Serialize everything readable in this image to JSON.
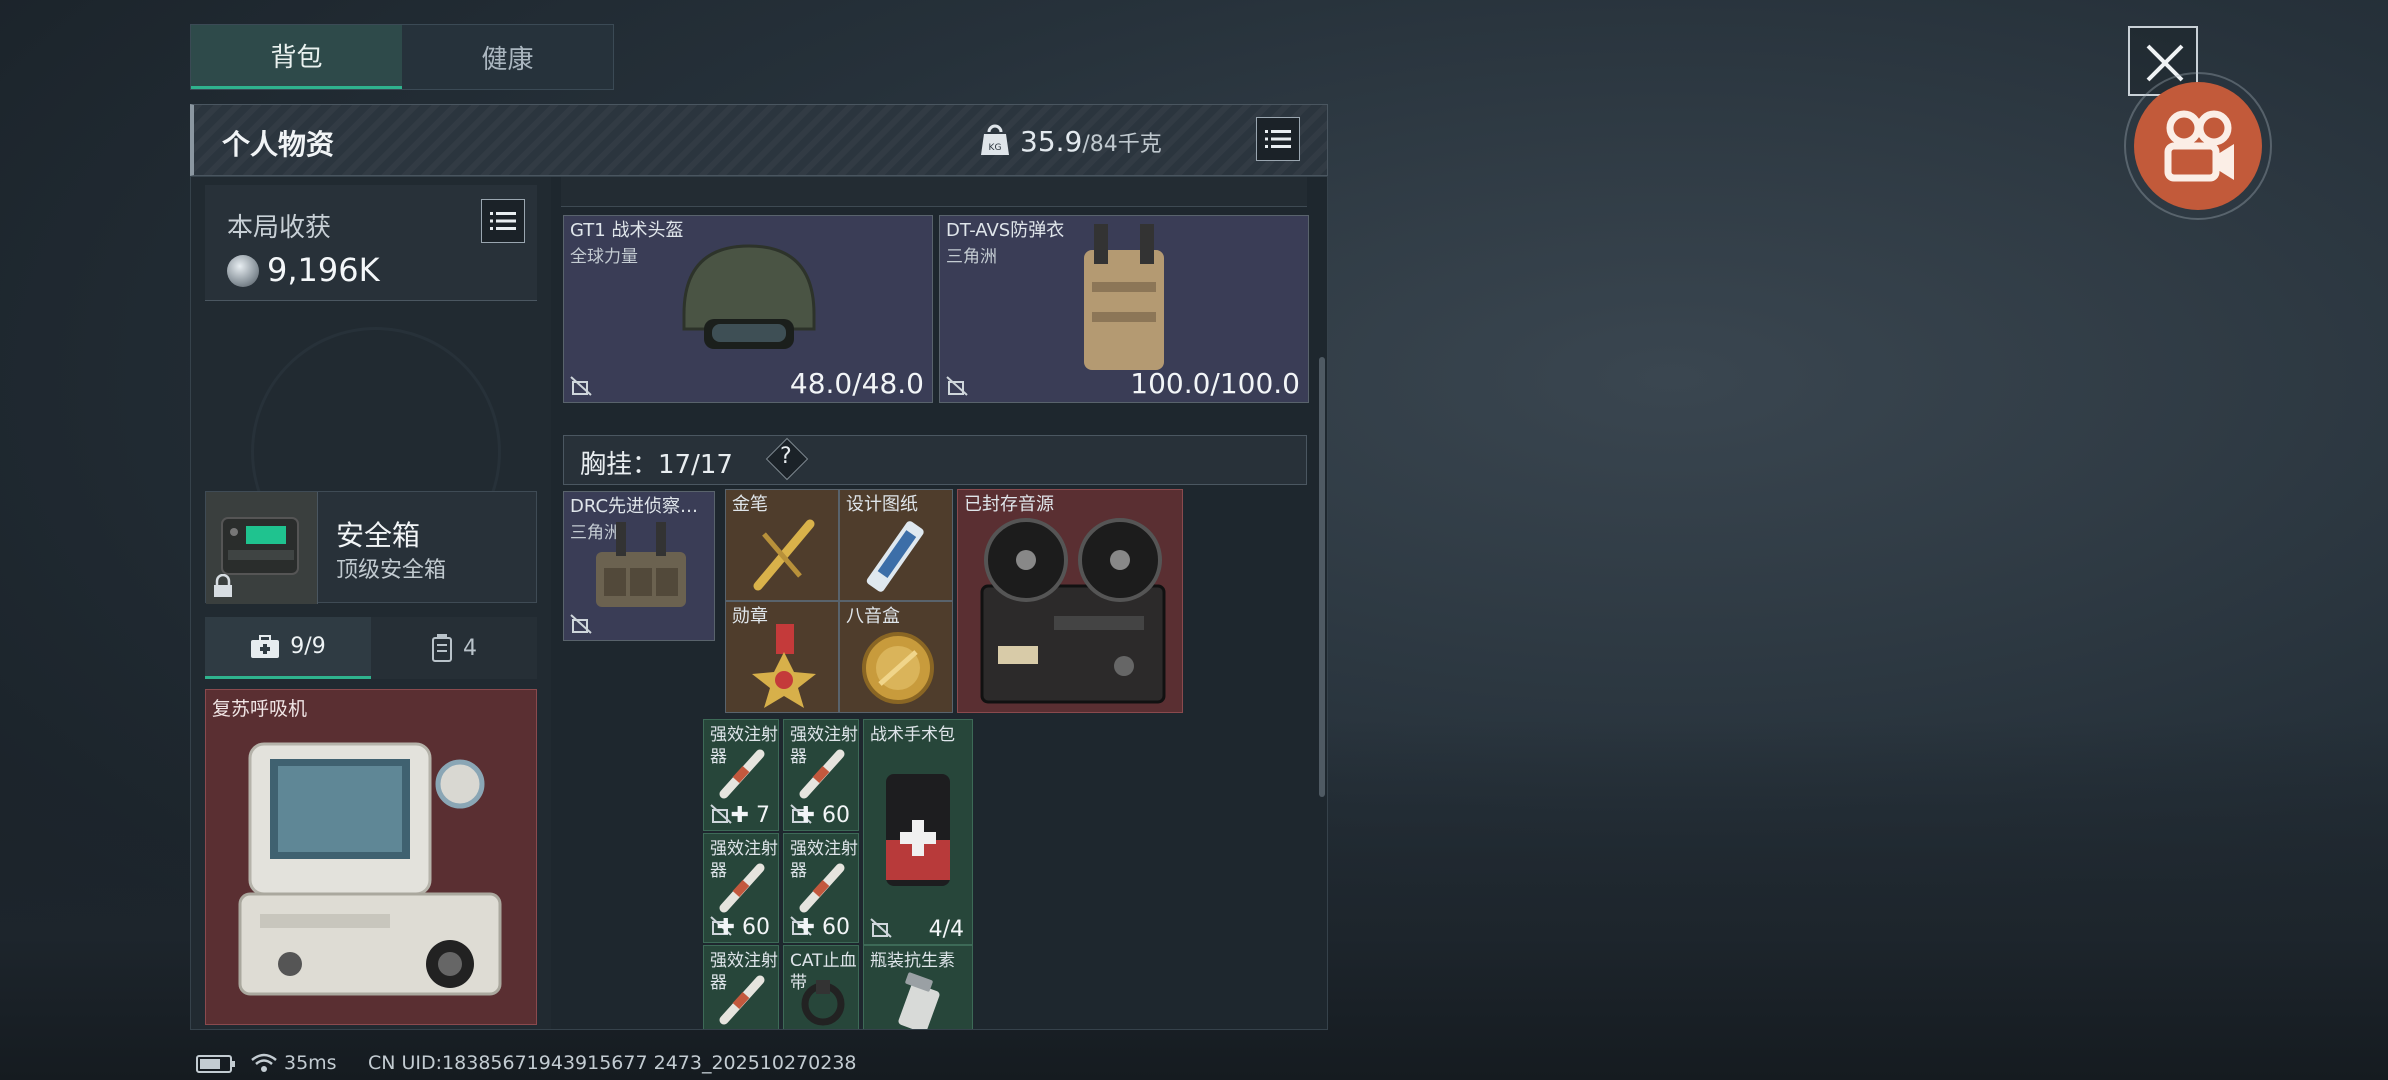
{
  "tabs": [
    {
      "label": "背包",
      "active": true
    },
    {
      "label": "健康",
      "active": false
    }
  ],
  "header": {
    "title": "个人物资",
    "weight_current": "35.9",
    "weight_max": "/84千克"
  },
  "harvest": {
    "label": "本局收获",
    "value": "9,196K"
  },
  "safebox": {
    "title": "安全箱",
    "subtitle": "顶级安全箱"
  },
  "subtabs": [
    {
      "label": "9/9",
      "icon": "medkit-icon",
      "active": true
    },
    {
      "label": "4",
      "icon": "canister-icon",
      "active": false
    }
  ],
  "left_item": {
    "label": "复苏呼吸机"
  },
  "gear": [
    {
      "name": "GT1 战术头盔",
      "sub": "全球力量",
      "value": "48.0/48.0"
    },
    {
      "name": "DT-AVS防弹衣",
      "sub": "三角洲",
      "value": "100.0/100.0"
    }
  ],
  "chest": {
    "label": "胸挂：17/17",
    "help": "?"
  },
  "chest_rig": {
    "name": "DRC先进侦察…",
    "sub": "三角洲"
  },
  "valuables": [
    {
      "name": "金笔"
    },
    {
      "name": "设计图纸"
    },
    {
      "name": "勋章"
    },
    {
      "name": "八音盒"
    }
  ],
  "record_item": {
    "name": "已封存音源"
  },
  "meds": [
    {
      "name": "强效注射器",
      "value": "7"
    },
    {
      "name": "强效注射器",
      "value": "60"
    },
    {
      "name": "战术手术包",
      "value": "4/4"
    },
    {
      "name": "强效注射器",
      "value": "60"
    },
    {
      "name": "强效注射器",
      "value": "60"
    },
    {
      "name": "强效注射器",
      "value": ""
    },
    {
      "name": "CAT止血带",
      "value": ""
    },
    {
      "name": "瓶装抗生素",
      "value": ""
    }
  ],
  "status": {
    "ping": "35ms",
    "uid": "CN UID:18385671943915677 2473_202510270238"
  },
  "colors": {
    "accent": "#2fb38e",
    "red_slot": "#5a2f32",
    "green_slot": "#27463a",
    "purple_slot": "#3a3d56",
    "gold_slot": "#4f3d2c",
    "record": "#c25a3a"
  }
}
